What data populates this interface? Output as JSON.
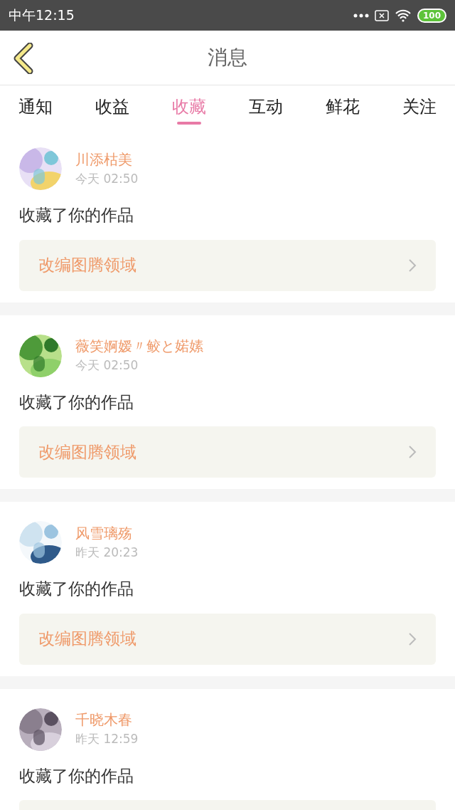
{
  "status_bar": {
    "time": "中午12:15",
    "battery": "100"
  },
  "header": {
    "title": "消息"
  },
  "tabs": [
    {
      "label": "通知",
      "selected": false
    },
    {
      "label": "收益",
      "selected": false
    },
    {
      "label": "收藏",
      "selected": true
    },
    {
      "label": "互动",
      "selected": false
    },
    {
      "label": "鲜花",
      "selected": false
    },
    {
      "label": "关注",
      "selected": false
    }
  ],
  "messages": [
    {
      "user": "川添枯美",
      "time": "今天 02:50",
      "text": "收藏了你的作品",
      "work": "改编图腾领域"
    },
    {
      "user": "薇笑婀嫒〃鲛と婼嫊",
      "time": "今天 02:50",
      "text": "收藏了你的作品",
      "work": "改编图腾领域"
    },
    {
      "user": "风雪璃殇",
      "time": "昨天 20:23",
      "text": "收藏了你的作品",
      "work": "改编图腾领域"
    },
    {
      "user": "千晓木春",
      "time": "昨天 12:59",
      "text": "收藏了你的作品"
    }
  ]
}
